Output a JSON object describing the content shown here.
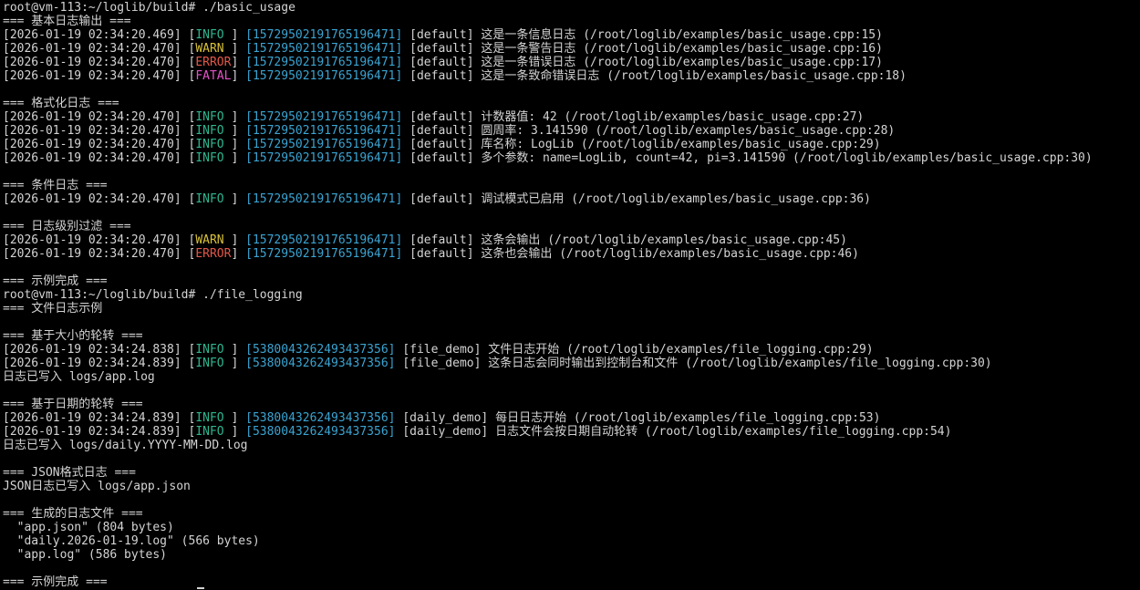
{
  "colors": {
    "background": "#000000",
    "text": "#d4d4d4",
    "info": "#2fb58f",
    "warn": "#d8c13a",
    "error": "#e4584a",
    "fatal": "#e454c9",
    "thread_id": "#3aa4d2"
  },
  "lines": [
    {
      "kind": "prompt",
      "prompt": "root@vm-113:~/loglib/build# ",
      "command": "./basic_usage"
    },
    {
      "kind": "text",
      "text": "=== 基本日志输出 ==="
    },
    {
      "kind": "log",
      "time": "[2026-01-19 02:34:20.469] ",
      "level": "INFO ",
      "level_class": "info",
      "tid": "15729502191765196471",
      "logger": " [default] ",
      "message": "这是一条信息日志 (/root/loglib/examples/basic_usage.cpp:15)"
    },
    {
      "kind": "log",
      "time": "[2026-01-19 02:34:20.470] ",
      "level": "WARN ",
      "level_class": "warn",
      "tid": "15729502191765196471",
      "logger": " [default] ",
      "message": "这是一条警告日志 (/root/loglib/examples/basic_usage.cpp:16)"
    },
    {
      "kind": "log",
      "time": "[2026-01-19 02:34:20.470] ",
      "level": "ERROR",
      "level_class": "error",
      "tid": "15729502191765196471",
      "logger": " [default] ",
      "message": "这是一条错误日志 (/root/loglib/examples/basic_usage.cpp:17)"
    },
    {
      "kind": "log",
      "time": "[2026-01-19 02:34:20.470] ",
      "level": "FATAL",
      "level_class": "fatal",
      "tid": "15729502191765196471",
      "logger": " [default] ",
      "message": "这是一条致命错误日志 (/root/loglib/examples/basic_usage.cpp:18)"
    },
    {
      "kind": "blank"
    },
    {
      "kind": "text",
      "text": "=== 格式化日志 ==="
    },
    {
      "kind": "log",
      "time": "[2026-01-19 02:34:20.470] ",
      "level": "INFO ",
      "level_class": "info",
      "tid": "15729502191765196471",
      "logger": " [default] ",
      "message": "计数器值: 42 (/root/loglib/examples/basic_usage.cpp:27)"
    },
    {
      "kind": "log",
      "time": "[2026-01-19 02:34:20.470] ",
      "level": "INFO ",
      "level_class": "info",
      "tid": "15729502191765196471",
      "logger": " [default] ",
      "message": "圆周率: 3.141590 (/root/loglib/examples/basic_usage.cpp:28)"
    },
    {
      "kind": "log",
      "time": "[2026-01-19 02:34:20.470] ",
      "level": "INFO ",
      "level_class": "info",
      "tid": "15729502191765196471",
      "logger": " [default] ",
      "message": "库名称: LogLib (/root/loglib/examples/basic_usage.cpp:29)"
    },
    {
      "kind": "log",
      "time": "[2026-01-19 02:34:20.470] ",
      "level": "INFO ",
      "level_class": "info",
      "tid": "15729502191765196471",
      "logger": " [default] ",
      "message": "多个参数: name=LogLib, count=42, pi=3.141590 (/root/loglib/examples/basic_usage.cpp:30)"
    },
    {
      "kind": "blank"
    },
    {
      "kind": "text",
      "text": "=== 条件日志 ==="
    },
    {
      "kind": "log",
      "time": "[2026-01-19 02:34:20.470] ",
      "level": "INFO ",
      "level_class": "info",
      "tid": "15729502191765196471",
      "logger": " [default] ",
      "message": "调试模式已启用 (/root/loglib/examples/basic_usage.cpp:36)"
    },
    {
      "kind": "blank"
    },
    {
      "kind": "text",
      "text": "=== 日志级别过滤 ==="
    },
    {
      "kind": "log",
      "time": "[2026-01-19 02:34:20.470] ",
      "level": "WARN ",
      "level_class": "warn",
      "tid": "15729502191765196471",
      "logger": " [default] ",
      "message": "这条会输出 (/root/loglib/examples/basic_usage.cpp:45)"
    },
    {
      "kind": "log",
      "time": "[2026-01-19 02:34:20.470] ",
      "level": "ERROR",
      "level_class": "error",
      "tid": "15729502191765196471",
      "logger": " [default] ",
      "message": "这条也会输出 (/root/loglib/examples/basic_usage.cpp:46)"
    },
    {
      "kind": "blank"
    },
    {
      "kind": "text",
      "text": "=== 示例完成 ==="
    },
    {
      "kind": "prompt",
      "prompt": "root@vm-113:~/loglib/build# ",
      "command": "./file_logging"
    },
    {
      "kind": "text",
      "text": "=== 文件日志示例"
    },
    {
      "kind": "blank"
    },
    {
      "kind": "text",
      "text": "=== 基于大小的轮转 ==="
    },
    {
      "kind": "log",
      "time": "[2026-01-19 02:34:24.838] ",
      "level": "INFO ",
      "level_class": "info",
      "tid": "5380043262493437356",
      "logger": " [file_demo] ",
      "message": "文件日志开始 (/root/loglib/examples/file_logging.cpp:29)"
    },
    {
      "kind": "log",
      "time": "[2026-01-19 02:34:24.839] ",
      "level": "INFO ",
      "level_class": "info",
      "tid": "5380043262493437356",
      "logger": " [file_demo] ",
      "message": "这条日志会同时输出到控制台和文件 (/root/loglib/examples/file_logging.cpp:30)"
    },
    {
      "kind": "text",
      "text": "日志已写入 logs/app.log"
    },
    {
      "kind": "blank"
    },
    {
      "kind": "text",
      "text": "=== 基于日期的轮转 ==="
    },
    {
      "kind": "log",
      "time": "[2026-01-19 02:34:24.839] ",
      "level": "INFO ",
      "level_class": "info",
      "tid": "5380043262493437356",
      "logger": " [daily_demo] ",
      "message": "每日日志开始 (/root/loglib/examples/file_logging.cpp:53)"
    },
    {
      "kind": "log",
      "time": "[2026-01-19 02:34:24.839] ",
      "level": "INFO ",
      "level_class": "info",
      "tid": "5380043262493437356",
      "logger": " [daily_demo] ",
      "message": "日志文件会按日期自动轮转 (/root/loglib/examples/file_logging.cpp:54)"
    },
    {
      "kind": "text",
      "text": "日志已写入 logs/daily.YYYY-MM-DD.log"
    },
    {
      "kind": "blank"
    },
    {
      "kind": "text",
      "text": "=== JSON格式日志 ==="
    },
    {
      "kind": "text",
      "text": "JSON日志已写入 logs/app.json"
    },
    {
      "kind": "blank"
    },
    {
      "kind": "text",
      "text": "=== 生成的日志文件 ==="
    },
    {
      "kind": "text",
      "text": "  \"app.json\" (804 bytes)"
    },
    {
      "kind": "text",
      "text": "  \"daily.2026-01-19.log\" (566 bytes)"
    },
    {
      "kind": "text",
      "text": "  \"app.log\" (586 bytes)"
    },
    {
      "kind": "blank"
    },
    {
      "kind": "text",
      "text": "=== 示例完成 ===",
      "cursor": true
    }
  ]
}
